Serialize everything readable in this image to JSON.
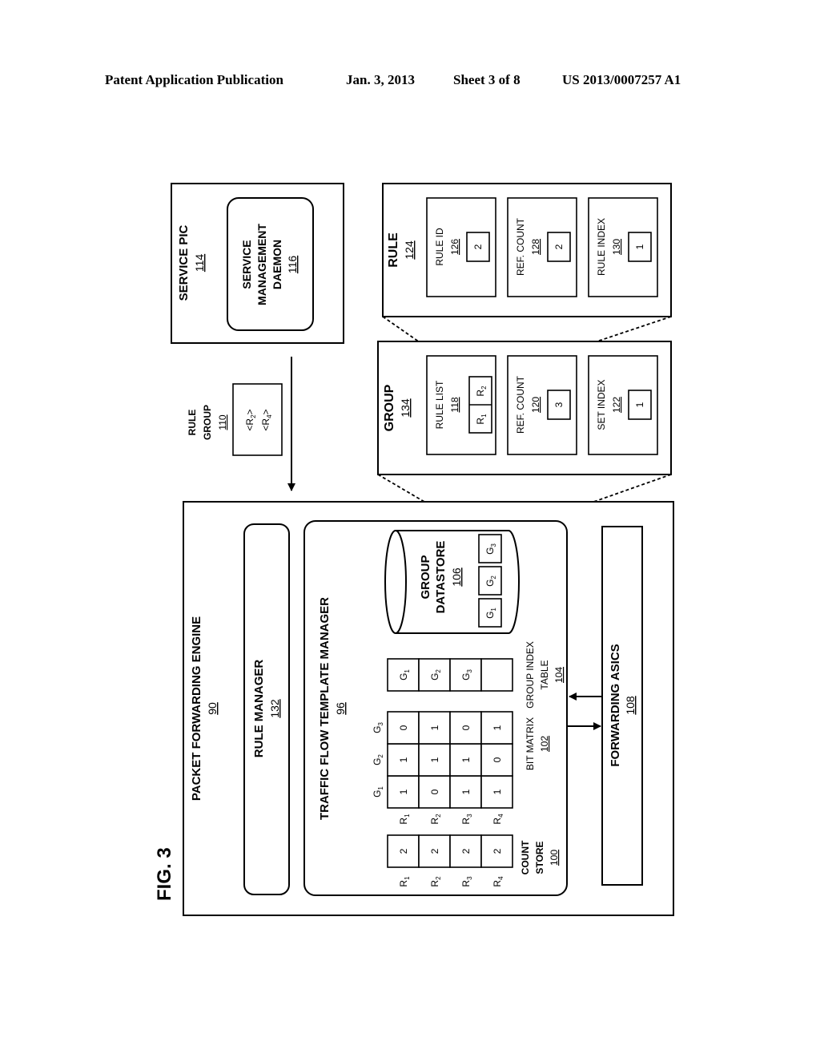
{
  "header": {
    "publication": "Patent Application Publication",
    "date": "Jan. 3, 2013",
    "sheet": "Sheet 3 of 8",
    "number": "US 2013/0007257 A1"
  },
  "figure": {
    "label": "FIG. 3",
    "service_pic": {
      "title": "SERVICE PIC",
      "ref": "114"
    },
    "daemon": {
      "line1": "SERVICE",
      "line2": "MANAGEMENT",
      "line3": "DAEMON",
      "ref": "116"
    },
    "rule_group": {
      "line1": "RULE",
      "line2": "GROUP",
      "ref": "110",
      "entries": [
        "<R",
        "2",
        ">",
        "<R",
        "4",
        ">"
      ]
    },
    "rule": {
      "title": "RULE",
      "ref": "124",
      "fields": [
        {
          "label": "RULE ID",
          "ref": "126",
          "value": "2"
        },
        {
          "label": "REF. COUNT",
          "ref": "128",
          "value": "2"
        },
        {
          "label": "RULE INDEX",
          "ref": "130",
          "value": "1"
        }
      ]
    },
    "group": {
      "title": "GROUP",
      "ref": "134",
      "rule_list": {
        "label": "RULE LIST",
        "ref": "118",
        "items": [
          "R",
          "1",
          "R",
          "2"
        ]
      },
      "ref_count": {
        "label": "REF. COUNT",
        "ref": "120",
        "value": "3"
      },
      "set_index": {
        "label": "SET INDEX",
        "ref": "122",
        "value": "1"
      }
    },
    "pfe": {
      "title": "PACKET FORWARDING ENGINE",
      "ref": "90"
    },
    "rule_manager": {
      "title": "RULE MANAGER",
      "ref": "132"
    },
    "tftm": {
      "title": "TRAFFIC FLOW TEMPLATE MANAGER",
      "ref": "96"
    },
    "group_datastore": {
      "line1": "GROUP",
      "line2": "DATASTORE",
      "ref": "106",
      "items": [
        "G",
        "1",
        "G",
        "2",
        "G",
        "3"
      ]
    },
    "count_store": {
      "line1": "COUNT",
      "line2": "STORE",
      "ref": "100",
      "rows": [
        "R",
        "1",
        "R",
        "2",
        "R",
        "3",
        "R",
        "4"
      ],
      "values": [
        "2",
        "2",
        "2",
        "2"
      ]
    },
    "bit_matrix": {
      "label": "BIT MATRIX",
      "ref": "102",
      "cols": [
        "G",
        "1",
        "G",
        "2",
        "G",
        "3"
      ],
      "rows": [
        "R",
        "1",
        "R",
        "2",
        "R",
        "3",
        "R",
        "4"
      ],
      "cells": [
        [
          "1",
          "1",
          "0"
        ],
        [
          "0",
          "1",
          "1"
        ],
        [
          "1",
          "1",
          "0"
        ],
        [
          "1",
          "0",
          "1"
        ]
      ]
    },
    "group_index_table": {
      "line1": "GROUP INDEX",
      "line2": "TABLE",
      "ref": "104",
      "items": [
        "G",
        "1",
        "G",
        "2",
        "G",
        "3",
        ""
      ]
    },
    "forwarding_asics": {
      "title": "FORWARDING ASICS",
      "ref": "108"
    }
  }
}
